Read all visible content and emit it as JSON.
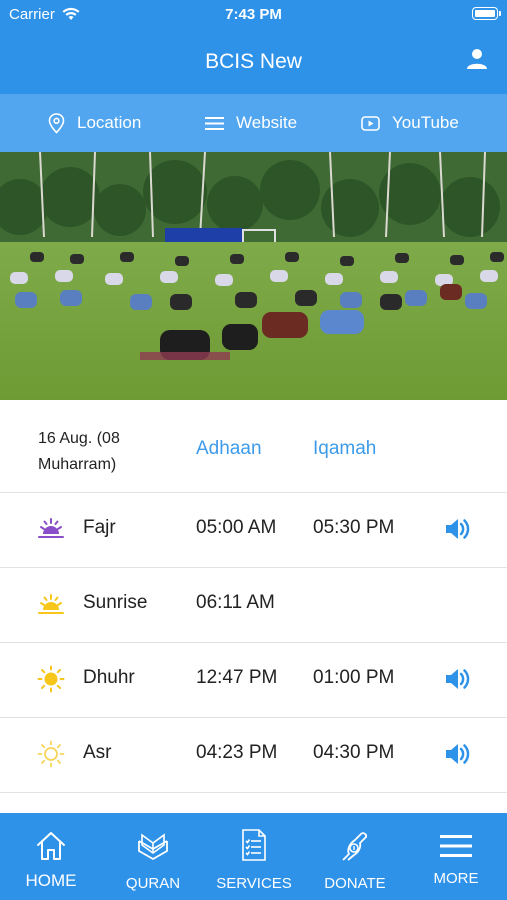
{
  "status_bar": {
    "carrier": "Carrier",
    "time": "7:43 PM"
  },
  "header": {
    "title": "BCIS New"
  },
  "subnav": [
    {
      "label": "Location",
      "icon": "location-pin-icon"
    },
    {
      "label": "Website",
      "icon": "menu-lines-icon"
    },
    {
      "label": "YouTube",
      "icon": "youtube-play-icon"
    }
  ],
  "hero": {
    "description_icon": "outdoor-prayer-photo"
  },
  "prayer_table": {
    "date": "16 Aug. (08 Muharram)",
    "col_adhaan": "Adhaan",
    "col_iqamah": "Iqamah",
    "rows": [
      {
        "name": "Fajr",
        "adhaan": "05:00 AM",
        "iqamah": "05:30 PM",
        "icon": "fajr-sunrise-icon",
        "sound": true
      },
      {
        "name": "Sunrise",
        "adhaan": "06:11 AM",
        "iqamah": "",
        "icon": "sunrise-icon",
        "sound": false
      },
      {
        "name": "Dhuhr",
        "adhaan": "12:47 PM",
        "iqamah": "01:00 PM",
        "icon": "sun-icon",
        "sound": true
      },
      {
        "name": "Asr",
        "adhaan": "04:23 PM",
        "iqamah": "04:30 PM",
        "icon": "sun-outline-icon",
        "sound": true
      }
    ]
  },
  "tabbar": [
    {
      "label": "HOME",
      "icon": "home-icon"
    },
    {
      "label": "QURAN",
      "icon": "quran-icon"
    },
    {
      "label": "SERVICES",
      "icon": "clipboard-icon"
    },
    {
      "label": "DONATE",
      "icon": "donate-hand-icon"
    },
    {
      "label": "MORE",
      "icon": "hamburger-icon"
    }
  ],
  "colors": {
    "primary": "#2f92e9",
    "subnav": "#51a6ef",
    "accent_text": "#3d9bea"
  }
}
